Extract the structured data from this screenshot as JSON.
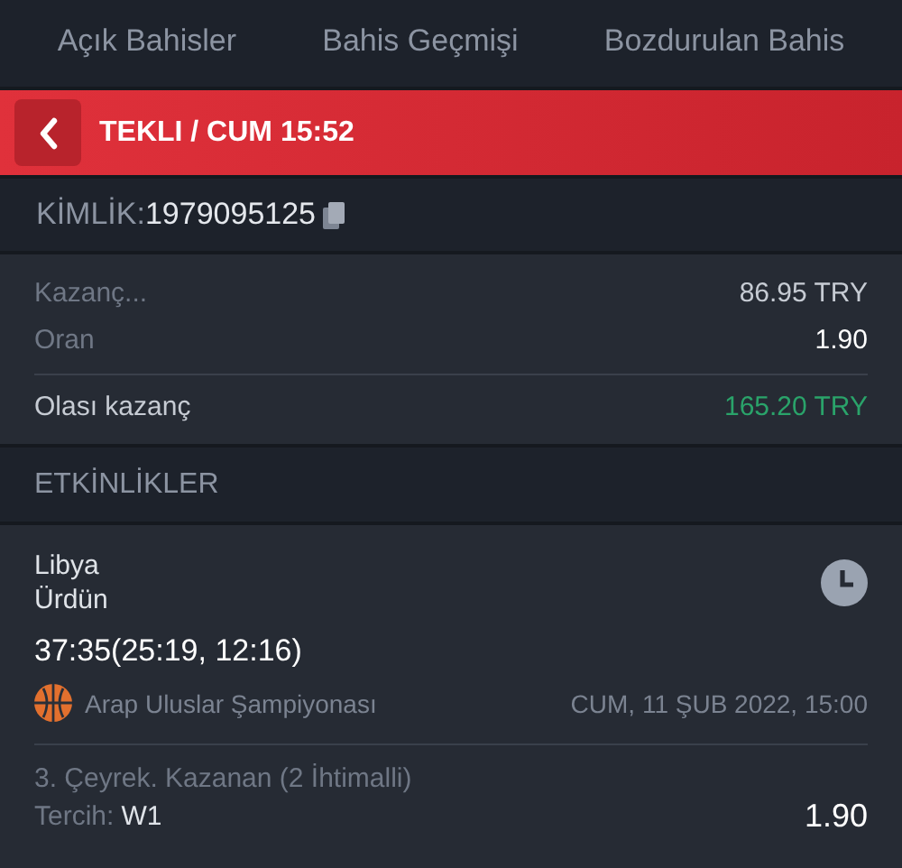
{
  "tabs": [
    {
      "label": "Açık Bahisler",
      "selected": false
    },
    {
      "label": "Bahis Geçmişi",
      "selected": false
    },
    {
      "label": "Bozdurulan Bahis",
      "selected": false
    }
  ],
  "header": {
    "title": "TEKLI / CUM 15:52"
  },
  "id_row": {
    "label": "KİMLİK:",
    "value": "1979095125"
  },
  "summary": [
    {
      "kind": "muted",
      "label": "Kazanç...",
      "value": "86.95 TRY"
    },
    {
      "kind": "strong",
      "label": "Oran",
      "value": "1.90"
    },
    {
      "kind": "total",
      "label": "Olası kazanç",
      "value": "165.20 TRY"
    }
  ],
  "section_title": "ETKİNLİKLER",
  "event": {
    "home": "Libya",
    "away": "Ürdün",
    "score": "37:35(25:19, 12:16)",
    "league": "Arap Uluslar Şampiyonası",
    "date": "CUM, 11 ŞUB 2022, 15:00",
    "market": "3. Çeyrek. Kazanan (2 İhtimalli)",
    "pick_label": "Tercih:",
    "pick": "W1",
    "odds": "1.90"
  }
}
